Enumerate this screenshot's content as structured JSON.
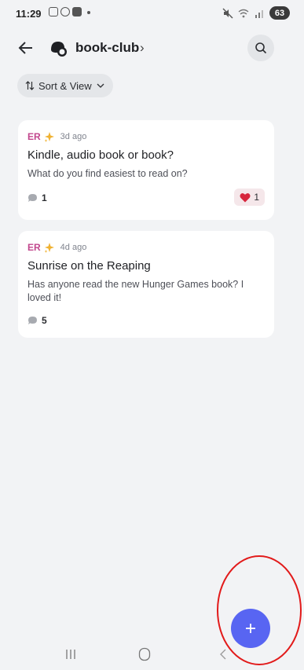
{
  "status_bar": {
    "time": "11:29",
    "battery": "63"
  },
  "header": {
    "channel_name": "book-club",
    "chevron": "›"
  },
  "sort": {
    "label": "Sort & View"
  },
  "posts": [
    {
      "author": "ER",
      "time_ago": "3d ago",
      "title": "Kindle, audio book or book?",
      "body": "What do you find easiest to read on?",
      "comments": "1",
      "reaction_count": "1"
    },
    {
      "author": "ER",
      "time_ago": "4d ago",
      "title": "Sunrise on the Reaping",
      "body": "Has anyone read the new Hunger Games book? I loved it!",
      "comments": "5"
    }
  ],
  "fab": {
    "label": "+"
  },
  "colors": {
    "accent": "#5865f2",
    "author": "#c2478d",
    "annotation": "#e21a1a",
    "background": "#f2f3f5"
  }
}
